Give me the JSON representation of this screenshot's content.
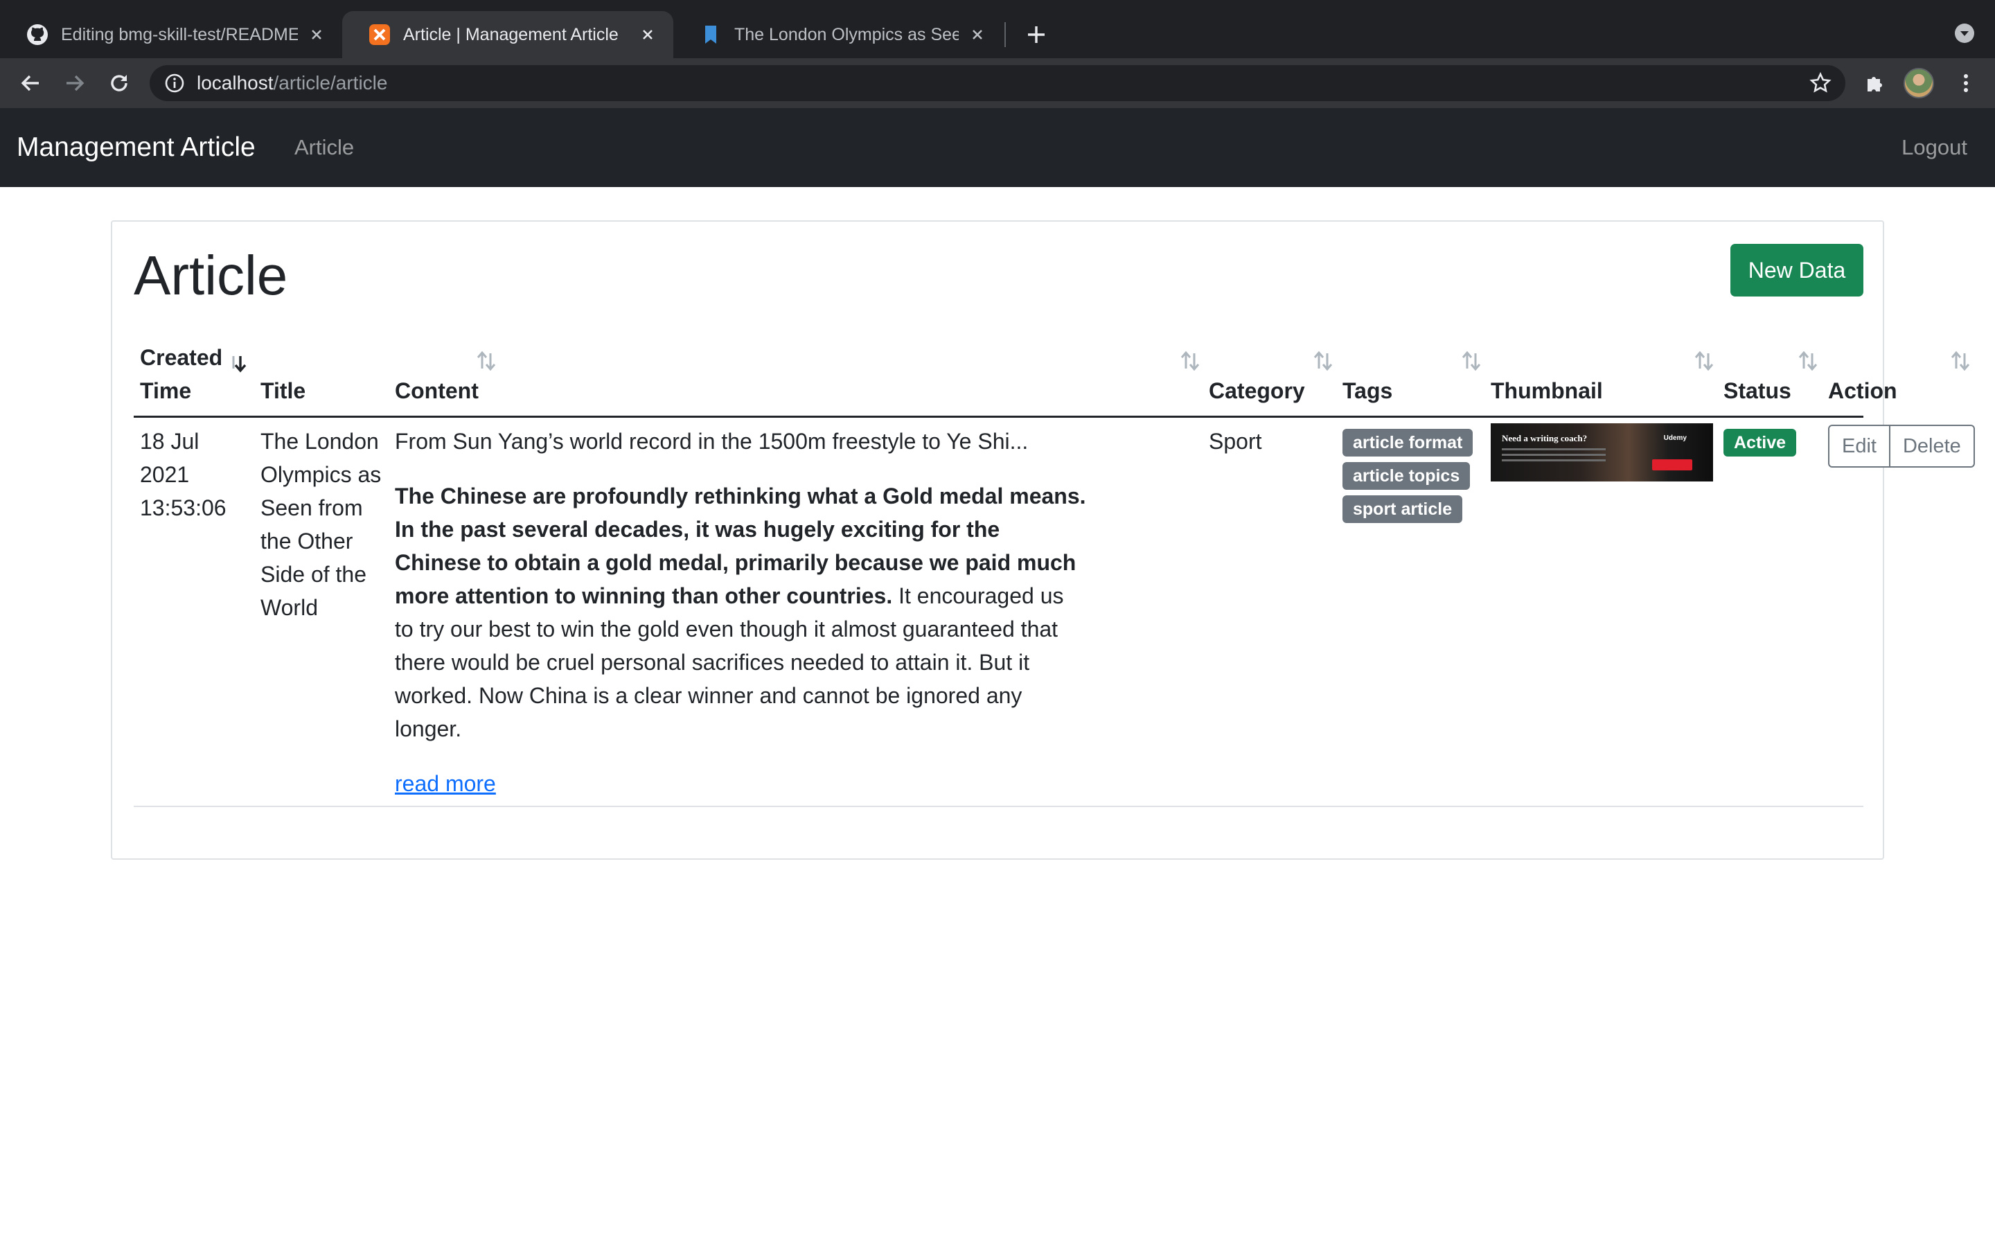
{
  "browser": {
    "tabs": [
      {
        "title": "Editing bmg-skill-test/README.md",
        "icon": "github-icon",
        "active": false
      },
      {
        "title": "Article | Management Article",
        "icon": "xampp-icon",
        "active": true
      },
      {
        "title": "The London Olympics as Seen from the Other Side of the World",
        "icon": "bookmark-icon",
        "active": false
      }
    ],
    "url_host": "localhost",
    "url_path": "/article/article"
  },
  "navbar": {
    "brand": "Management Article",
    "links": [
      "Article"
    ],
    "logout": "Logout"
  },
  "page": {
    "title": "Article",
    "new_button": "New Data"
  },
  "table": {
    "columns": [
      "Created Time",
      "Title",
      "Content",
      "Category",
      "Tags",
      "Thumbnail",
      "Status",
      "Action"
    ],
    "rows": [
      {
        "created_time_line1": "18 Jul",
        "created_time_line2": "2021",
        "created_time_line3": "13:53:06",
        "title": "The London Olympics as Seen from the Other Side of the World",
        "content_lead": "From Sun Yang’s world record in the 1500m freestyle to Ye Shi...",
        "content_bold": "The Chinese are profoundly rethinking what a Gold medal means. In the past several decades, it was hugely exciting for the Chinese to obtain a gold medal, primarily because we paid much more attention to winning than other countries.",
        "content_rest": " It encouraged us to try our best to win the gold even though it almost guaranteed that there would be cruel personal sacrifices needed to attain it. But it worked. Now China is a clear winner and cannot be ignored any longer.",
        "read_more": "read more",
        "category": "Sport",
        "tags": [
          "article format",
          "article topics",
          "sport article"
        ],
        "thumbnail": {
          "heading": "Need a writing coach?",
          "brand": "Udemy"
        },
        "status": "Active",
        "actions": [
          "Edit",
          "Delete"
        ]
      }
    ]
  },
  "colors": {
    "navbar_bg": "#212529",
    "success": "#198754",
    "badge_secondary": "#6c757d",
    "link": "#0d6efd"
  }
}
